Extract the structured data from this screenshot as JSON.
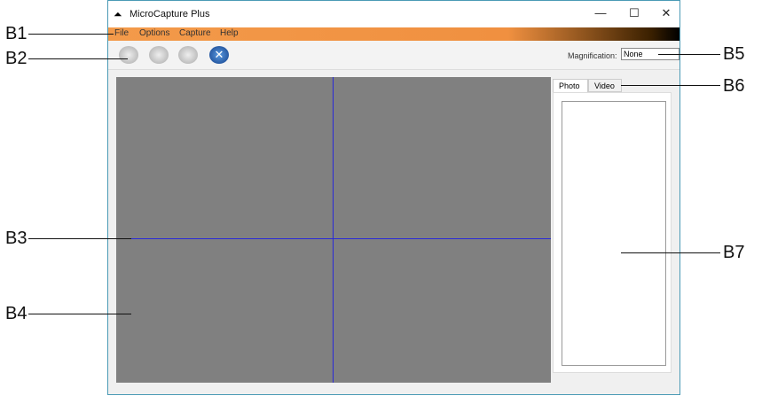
{
  "window": {
    "title": "MicroCapture Plus",
    "controls": [
      "—",
      "☐",
      "✕"
    ]
  },
  "menu": [
    "File",
    "Options",
    "Capture",
    "Help"
  ],
  "toolbar": {
    "magnification_label": "Magnification:",
    "magnification_value": "None"
  },
  "tabs": [
    "Photo",
    "Video"
  ],
  "callouts": [
    "B1",
    "B2",
    "B3",
    "B4",
    "B5",
    "B6",
    "B7"
  ]
}
